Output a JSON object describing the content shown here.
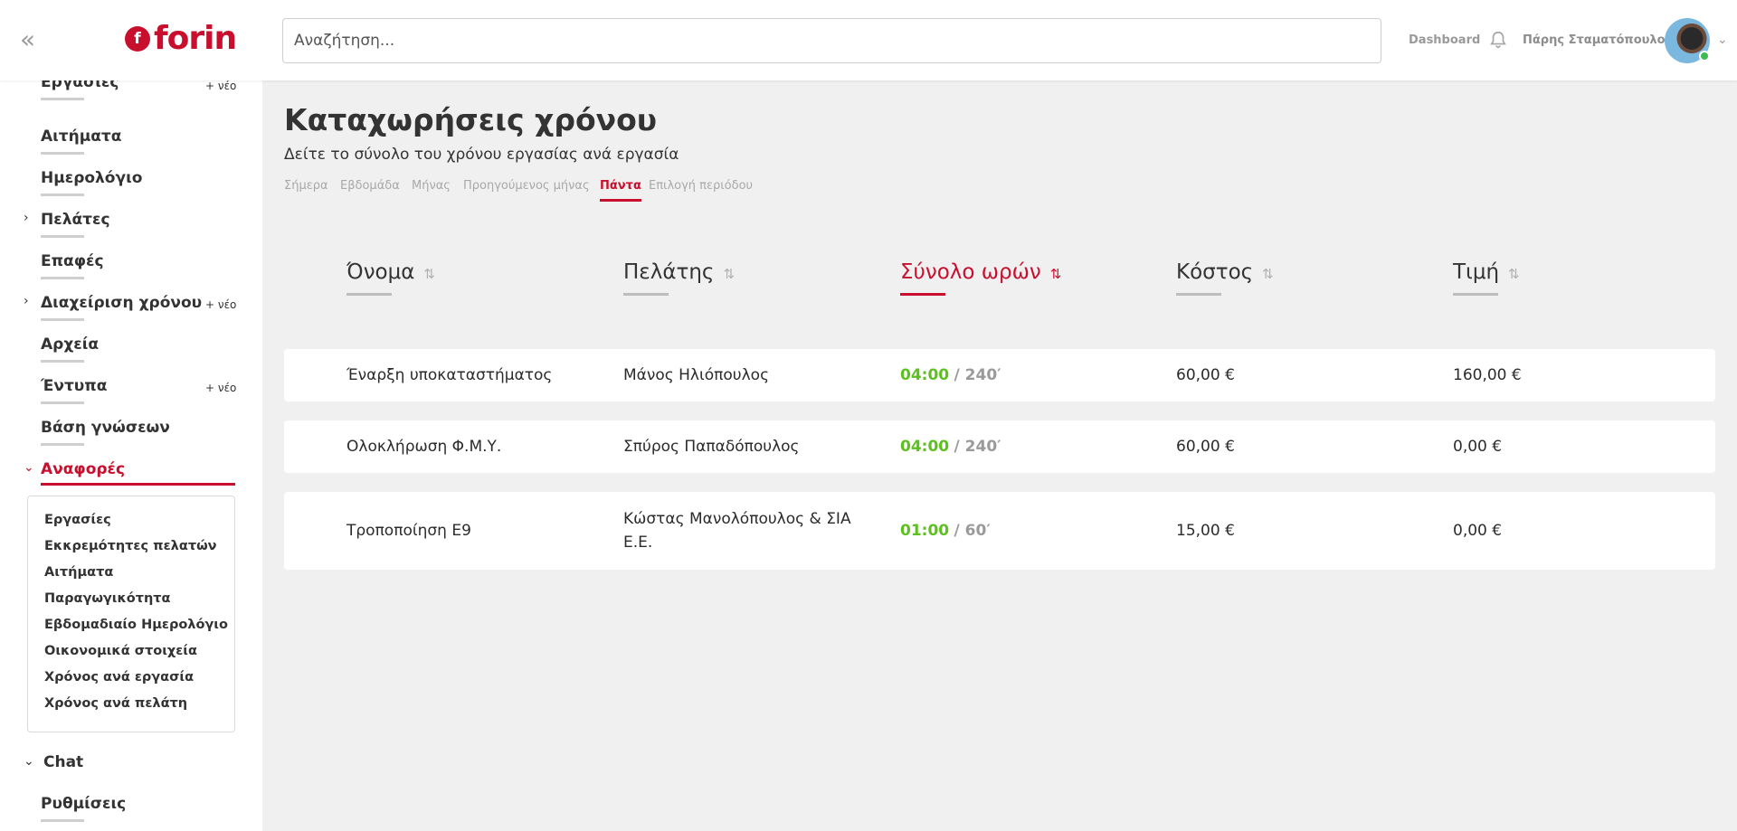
{
  "brand": {
    "name": "forin",
    "mark": "f"
  },
  "header": {
    "collapse_icon": "«",
    "search_placeholder": "Αναζήτηση...",
    "dashboard_label": "Dashboard",
    "user_name": "Πάρης Σταματόπουλος",
    "user_menu_icon": "⌄"
  },
  "sidebar": {
    "partial_top": {
      "label": "Εργασίες",
      "new": "+ νέο"
    },
    "items": [
      {
        "label": "Αιτήματα"
      },
      {
        "label": "Ημερολόγιο"
      },
      {
        "label": "Πελάτες",
        "chevron": "›"
      },
      {
        "label": "Επαφές"
      },
      {
        "label": "Διαχείριση χρόνου",
        "chevron": "›",
        "new": "+ νέο"
      },
      {
        "label": "Αρχεία"
      },
      {
        "label": "Έντυπα",
        "new": "+ νέο"
      },
      {
        "label": "Βάση γνώσεων"
      },
      {
        "label": "Αναφορές",
        "chevron": "⌄",
        "active": true
      }
    ],
    "reports_sub": [
      "Εργασίες",
      "Εκκρεμότητες πελατών",
      "Αιτήματα",
      "Παραγωγικότητα",
      "Εβδομαδιαίο Ημερολόγιο",
      "Οικονομικά στοιχεία",
      "Χρόνος ανά εργασία",
      "Χρόνος ανά πελάτη"
    ],
    "bottom": [
      {
        "label": "Chat",
        "chevron": "⌄"
      },
      {
        "label": "Ρυθμίσεις"
      }
    ]
  },
  "main": {
    "title": "Καταχωρήσεις χρόνου",
    "subtitle": "Δείτε το σύνολο του χρόνου εργασίας ανά εργασία",
    "tabs": [
      "Σήμερα",
      "Εβδομάδα",
      "Μήνας",
      "Προηγούμενος μήνας",
      "Πάντα",
      "Επιλογή περιόδου"
    ],
    "active_tab": "Πάντα",
    "columns": [
      "Όνομα",
      "Πελάτης",
      "Σύνολο ωρών",
      "Κόστος",
      "Τιμή"
    ],
    "sort_icon": "⇅",
    "sort_active_icon": "⇅",
    "rows": [
      {
        "name": "Έναρξη υποκαταστήματος",
        "client": "Μάνος Ηλιόπουλος",
        "hours": "04:00",
        "minutes": "/ 240′",
        "cost": "60,00 €",
        "price": "160,00 €"
      },
      {
        "name": "Ολοκλήρωση Φ.Μ.Υ.",
        "client": "Σπύρος Παπαδόπουλος",
        "hours": "04:00",
        "minutes": "/ 240′",
        "cost": "60,00 €",
        "price": "0,00 €"
      },
      {
        "name": "Τροποποίηση Ε9",
        "client": "Κώστας Μανολόπουλος & ΣΙΑ Ε.Ε.",
        "hours": "01:00",
        "minutes": "/ 60′",
        "cost": "15,00 €",
        "price": "0,00 €"
      }
    ]
  },
  "colors": {
    "brand": "#c8102e",
    "hours": "#5cc11e",
    "background": "#f0f0f0"
  }
}
